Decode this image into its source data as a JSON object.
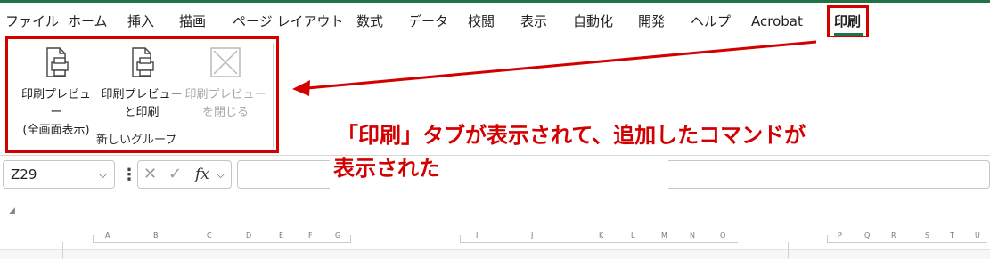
{
  "ribbon_tabs": [
    "ファイル",
    "ホーム",
    "挿入",
    "描画",
    "ページ レイアウト",
    "数式",
    "データ",
    "校閲",
    "表示",
    "自動化",
    "開発",
    "ヘルプ",
    "Acrobat",
    "印刷"
  ],
  "commands": [
    {
      "label": "印刷プレビュー\n(全画面表示)",
      "icon": "print-preview-icon",
      "enabled": true
    },
    {
      "label": "印刷プレビュー\nと印刷",
      "icon": "print-preview-print-icon",
      "enabled": true
    },
    {
      "label": "印刷プレビュー\nを閉じる",
      "icon": "close-preview-icon",
      "enabled": false
    }
  ],
  "group_label": "新しいグループ",
  "annotation": {
    "line1": "「印刷」タブが表示されて、追加したコマンドが",
    "line2": "表示された"
  },
  "formula_bar": {
    "name_box": "Z29",
    "fx": "fx"
  },
  "rulers": [
    {
      "letters": [
        "A",
        "B",
        "C",
        "D",
        "E",
        "F",
        "G"
      ]
    },
    {
      "letters": [
        "I",
        "J",
        "K",
        "L",
        "M",
        "N",
        "O"
      ]
    },
    {
      "letters": [
        "P",
        "Q",
        "R",
        "S",
        "T",
        "U"
      ]
    }
  ],
  "colors": {
    "accent": "#217346",
    "annotation": "#d40000"
  }
}
